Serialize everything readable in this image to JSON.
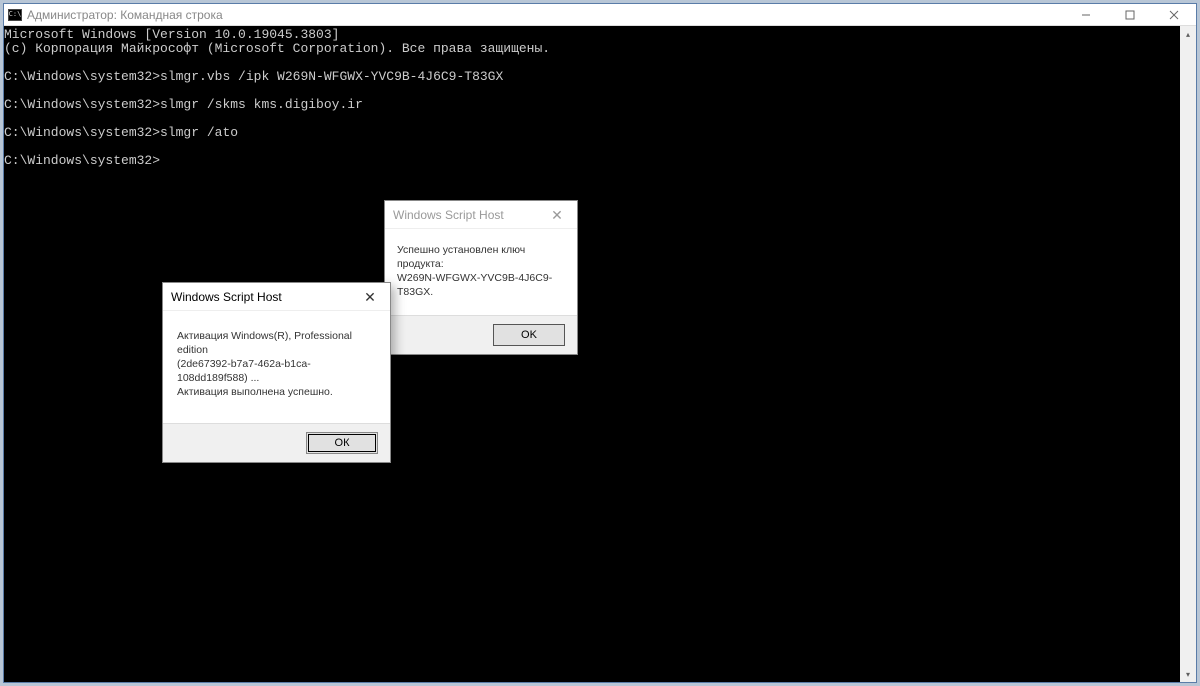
{
  "window": {
    "title": "Администратор: Командная строка",
    "icon_abbr": "C:\\"
  },
  "console": {
    "line1": "Microsoft Windows [Version 10.0.19045.3803]",
    "line2": "(c) Корпорация Майкрософт (Microsoft Corporation). Все права защищены.",
    "blank1": "",
    "prompt1_path": "C:\\Windows\\system32>",
    "prompt1_cmd": "slmgr.vbs /ipk W269N-WFGWX-YVC9B-4J6C9-T83GX",
    "blank2": "",
    "prompt2_path": "C:\\Windows\\system32>",
    "prompt2_cmd": "slmgr /skms kms.digiboy.ir",
    "blank3": "",
    "prompt3_path": "C:\\Windows\\system32>",
    "prompt3_cmd": "slmgr /ato",
    "blank4": "",
    "prompt4_path": "C:\\Windows\\system32>"
  },
  "dialog1": {
    "title": "Windows Script Host",
    "body_line1": "Успешно установлен ключ продукта:",
    "body_line2": "W269N-WFGWX-YVC9B-4J6C9-T83GX.",
    "ok": "OK"
  },
  "dialog2": {
    "title": "Windows Script Host",
    "body_line1": "Активация Windows(R), Professional edition",
    "body_line2": "(2de67392-b7a7-462a-b1ca-108dd189f588) ...",
    "body_line3": "Активация выполнена успешно.",
    "ok": "ОК"
  }
}
